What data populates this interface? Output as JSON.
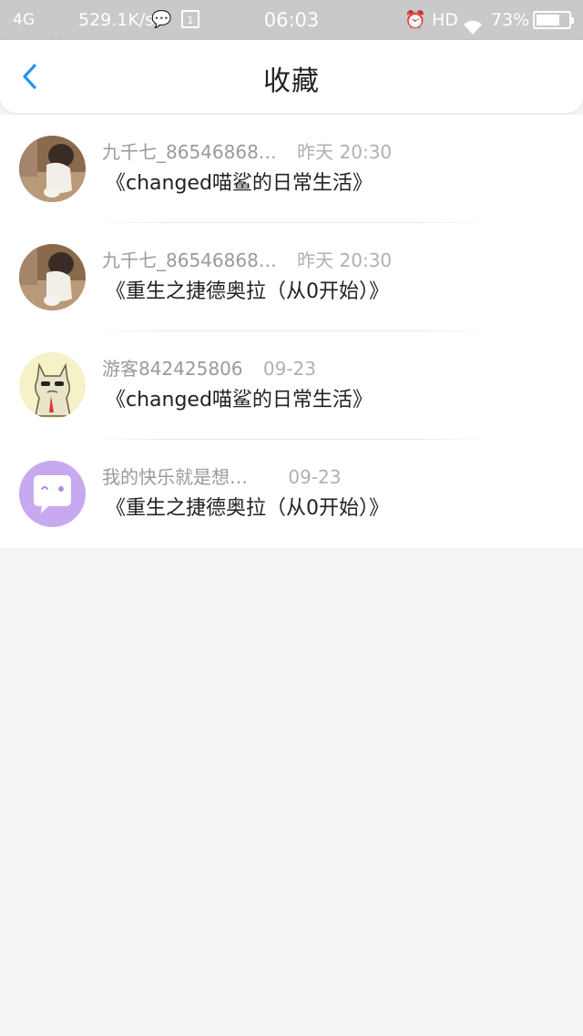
{
  "status_bar": {
    "network": "4G",
    "speed": "529.1K/s",
    "sim_label": "1",
    "time": "06:03",
    "hd_label": "HD",
    "battery_text": "73%",
    "battery_level": 0.73
  },
  "header": {
    "title": "收藏"
  },
  "favorites": [
    {
      "user": "九千七_86546868…",
      "time": "昨天 20:30",
      "title": "《changed喵鲨的日常生活》",
      "avatar": "child-photo"
    },
    {
      "user": "九千七_86546868…",
      "time": "昨天 20:30",
      "title": "《重生之捷德奥拉（从0开始）》",
      "avatar": "child-photo"
    },
    {
      "user": "游客842425806",
      "time": "09-23",
      "title": "《changed喵鲨的日常生活》",
      "avatar": "cat-drawing"
    },
    {
      "user": "我的快乐就是想…",
      "time": "09-23",
      "title": "《重生之捷德奥拉（从0开始）》",
      "avatar": "chat-bubble-face"
    }
  ],
  "colors": {
    "status_bar_bg": "#c9c9c9",
    "accent": "#2196f3",
    "page_bg": "#f5f5f5"
  }
}
